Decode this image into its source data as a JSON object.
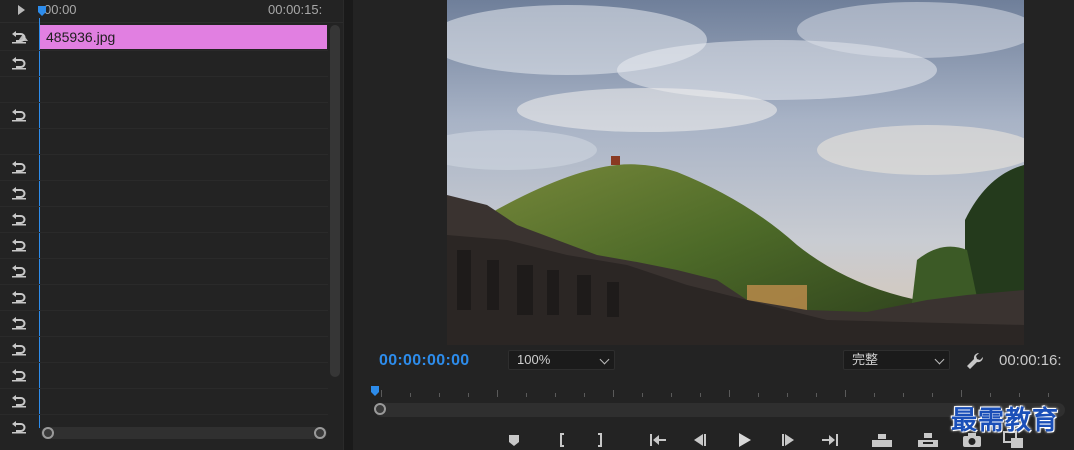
{
  "effect_controls": {
    "ruler": {
      "start_tc": "00:00",
      "end_tc": "00:00:15:"
    },
    "clip": {
      "name": "485936.jpg",
      "color": "#e17fe1"
    },
    "icons": {
      "play": "triangle-right-icon",
      "collapse": "triangle-up-icon",
      "reset": "reset-parameter-icon"
    }
  },
  "program_monitor": {
    "current_timecode": "00:00:00:00",
    "zoom_level": "100%",
    "playback_resolution": "完整",
    "duration_timecode": "00:00:16:",
    "accent_color": "#2d8ceb",
    "transport_icons": [
      "add-marker-icon",
      "mark-in-icon",
      "mark-out-icon",
      "go-to-in-icon",
      "step-back-icon",
      "play-icon",
      "step-forward-icon",
      "go-to-out-icon",
      "lift-icon",
      "extract-icon",
      "export-frame-icon",
      "compare-icon"
    ]
  },
  "watermark": {
    "text": "最需教育"
  }
}
